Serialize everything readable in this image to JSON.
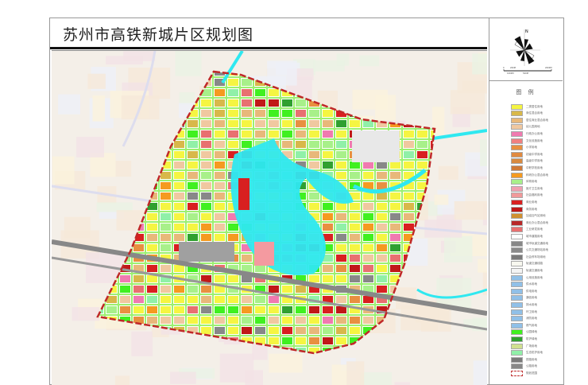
{
  "title": "苏州市高铁新城片区规划图",
  "compass": {
    "north": "N",
    "scale_labels": [
      "0",
      "200M",
      "1000M",
      "500M",
      "2000M"
    ]
  },
  "legend": {
    "title": "图 例",
    "items": [
      {
        "label": "二类居住用地",
        "color": "#f5f542"
      },
      {
        "label": "商住混合用地",
        "color": "#d8b84a"
      },
      {
        "label": "居住商业混合用地",
        "color": "#e8b87a"
      },
      {
        "label": "幼儿园用地",
        "color": "#f0c8a0"
      },
      {
        "label": "行政办公用地",
        "color": "#f07ab0"
      },
      {
        "label": "文化设施用地",
        "color": "#f08080"
      },
      {
        "label": "小学用地",
        "color": "#e89040"
      },
      {
        "label": "初级中学用地",
        "color": "#e08a40"
      },
      {
        "label": "高级中学用地",
        "color": "#d88a40"
      },
      {
        "label": "中职学校用地",
        "color": "#d07a38"
      },
      {
        "label": "科研办公混合用地",
        "color": "#f59a20"
      },
      {
        "label": "体育用地",
        "color": "#a8f08a"
      },
      {
        "label": "医疗卫生用地",
        "color": "#f0a0b0"
      },
      {
        "label": "社会福利用地",
        "color": "#f09a9a"
      },
      {
        "label": "商业用地",
        "color": "#d82020"
      },
      {
        "label": "商务用地",
        "color": "#c01818"
      },
      {
        "label": "加油加气站用地",
        "color": "#d09030"
      },
      {
        "label": "商业办公混合用地",
        "color": "#b82828"
      },
      {
        "label": "工业研发用地",
        "color": "#e87070"
      },
      {
        "label": "城市道路用地",
        "color": "#ffffff"
      },
      {
        "label": "城市轨道交通用地",
        "color": "#888888"
      },
      {
        "label": "公共交通场站用地",
        "color": "#8a8a8a"
      },
      {
        "label": "社会停车场用地",
        "color": "#7a7a7a"
      },
      {
        "label": "轨道交通线路",
        "color": "#f8f8f0"
      },
      {
        "label": "轨道交通用地",
        "color": "#f4f4f4"
      },
      {
        "label": "公用设施用地",
        "color": "#90c0e8"
      },
      {
        "label": "供水用地",
        "color": "#90c0e8"
      },
      {
        "label": "供电用地",
        "color": "#90c0e8"
      },
      {
        "label": "通信用地",
        "color": "#90c0e8"
      },
      {
        "label": "排水用地",
        "color": "#90c0e8"
      },
      {
        "label": "环卫用地",
        "color": "#90c0e8"
      },
      {
        "label": "消防用地",
        "color": "#90c0e8"
      },
      {
        "label": "燃气用地",
        "color": "#90c0e8"
      },
      {
        "label": "公园绿地",
        "color": "#40f020"
      },
      {
        "label": "防护绿地",
        "color": "#30a030"
      },
      {
        "label": "广场用地",
        "color": "#d0e090"
      },
      {
        "label": "生态防护用地",
        "color": "#90f0a8"
      },
      {
        "label": "铁路用地",
        "color": "#7a7a7a"
      },
      {
        "label": "公路用地",
        "color": "#888888"
      },
      {
        "label": "规划范围",
        "color": "#ffffff"
      }
    ]
  }
}
